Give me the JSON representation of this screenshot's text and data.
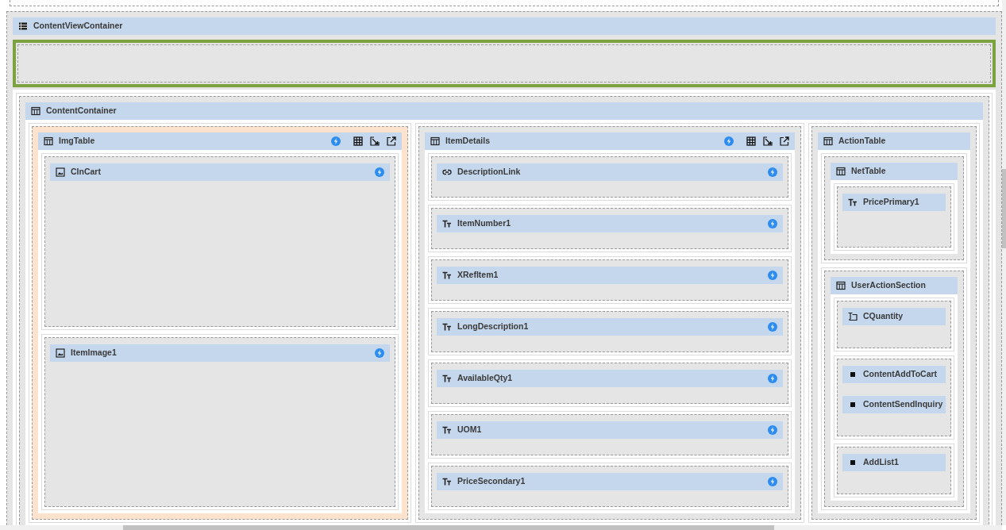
{
  "designer": {
    "root": {
      "kind": "list",
      "title": "ContentViewContainer",
      "selected": false,
      "drop_zone": true,
      "cells": [
        {
          "widgets": [
            {
              "kind": "table",
              "title": "ContentContainer",
              "selected": false,
              "columns": [
                {
                  "kind": "table",
                  "title": "ImgTable",
                  "selected": true,
                  "events": true,
                  "toolbar": true,
                  "cells": [
                    {
                      "widgets": [
                        {
                          "kind": "image",
                          "title": "CInCart",
                          "events": true
                        }
                      ]
                    },
                    {
                      "widgets": [
                        {
                          "kind": "image",
                          "title": "ItemImage1",
                          "events": true
                        }
                      ]
                    }
                  ]
                },
                {
                  "kind": "table",
                  "title": "ItemDetails",
                  "selected": false,
                  "events": true,
                  "toolbar": true,
                  "cells": [
                    {
                      "widgets": [
                        {
                          "kind": "link",
                          "title": "DescriptionLink",
                          "events": true
                        }
                      ]
                    },
                    {
                      "widgets": [
                        {
                          "kind": "text",
                          "title": "ItemNumber1",
                          "events": true
                        }
                      ]
                    },
                    {
                      "widgets": [
                        {
                          "kind": "text",
                          "title": "XRefItem1",
                          "events": true
                        }
                      ]
                    },
                    {
                      "widgets": [
                        {
                          "kind": "text",
                          "title": "LongDescription1",
                          "events": true
                        }
                      ]
                    },
                    {
                      "widgets": [
                        {
                          "kind": "text",
                          "title": "AvailableQty1",
                          "events": true
                        }
                      ]
                    },
                    {
                      "widgets": [
                        {
                          "kind": "text",
                          "title": "UOM1",
                          "events": true
                        }
                      ]
                    },
                    {
                      "widgets": [
                        {
                          "kind": "text",
                          "title": "PriceSecondary1",
                          "events": true
                        }
                      ]
                    }
                  ]
                },
                {
                  "kind": "table",
                  "title": "ActionTable",
                  "selected": false,
                  "cells": [
                    {
                      "widgets": [
                        {
                          "kind": "table",
                          "title": "NetTable",
                          "selected": false,
                          "cells": [
                            {
                              "widgets": [
                                {
                                  "kind": "text",
                                  "title": "PricePrimary1"
                                }
                              ]
                            }
                          ]
                        }
                      ]
                    },
                    {
                      "widgets": [
                        {
                          "kind": "table",
                          "title": "UserActionSection",
                          "selected": false,
                          "cells": [
                            {
                              "widgets": [
                                {
                                  "kind": "textbox",
                                  "title": "CQuantity"
                                }
                              ]
                            },
                            {
                              "widgets": [
                                {
                                  "kind": "button",
                                  "title": "ContentAddToCart"
                                },
                                {
                                  "kind": "button",
                                  "title": "ContentSendInquiry"
                                }
                              ]
                            },
                            {
                              "widgets": [
                                {
                                  "kind": "button",
                                  "title": "AddList1"
                                }
                              ]
                            }
                          ]
                        }
                      ]
                    }
                  ]
                }
              ]
            }
          ]
        }
      ]
    }
  }
}
